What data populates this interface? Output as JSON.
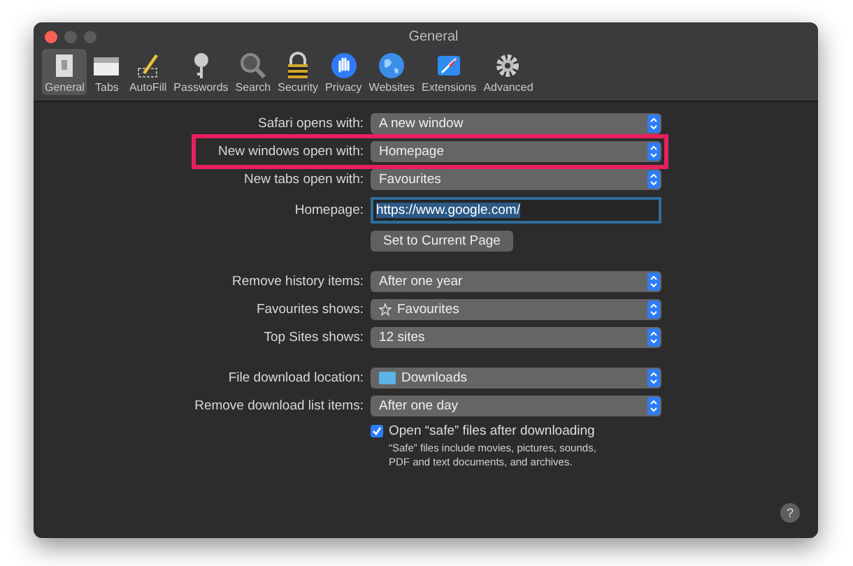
{
  "window": {
    "title": "General"
  },
  "toolbar": [
    {
      "label": "General",
      "selected": true
    },
    {
      "label": "Tabs",
      "selected": false
    },
    {
      "label": "AutoFill",
      "selected": false
    },
    {
      "label": "Passwords",
      "selected": false
    },
    {
      "label": "Search",
      "selected": false
    },
    {
      "label": "Security",
      "selected": false
    },
    {
      "label": "Privacy",
      "selected": false
    },
    {
      "label": "Websites",
      "selected": false
    },
    {
      "label": "Extensions",
      "selected": false
    },
    {
      "label": "Advanced",
      "selected": false
    }
  ],
  "sections": [
    {
      "rows": [
        {
          "kind": "popup",
          "label": "Safari opens with:",
          "value": "A new window",
          "highlighted": false
        },
        {
          "kind": "popup",
          "label": "New windows open with:",
          "value": "Homepage",
          "highlighted": true
        },
        {
          "kind": "popup",
          "label": "New tabs open with:",
          "value": "Favourites",
          "highlighted": false
        },
        {
          "kind": "field",
          "label": "Homepage:",
          "value": "https://www.google.com/",
          "highlighted": false
        },
        {
          "kind": "button",
          "value": "Set to Current Page",
          "highlighted": false
        }
      ]
    },
    {
      "rows": [
        {
          "kind": "popup",
          "label": "Remove history items:",
          "value": "After one year",
          "highlighted": false
        },
        {
          "kind": "starpopup",
          "label": "Favourites shows:",
          "value": "Favourites",
          "highlighted": false
        },
        {
          "kind": "popup",
          "label": "Top Sites shows:",
          "value": "12 sites",
          "highlighted": false
        }
      ]
    },
    {
      "rows": [
        {
          "kind": "folderpopup",
          "label": "File download location:",
          "value": "Downloads",
          "highlighted": false
        },
        {
          "kind": "popup",
          "label": "Remove download list items:",
          "value": "After one day",
          "highlighted": false
        },
        {
          "kind": "checkbox",
          "value": "Open “safe” files after downloading",
          "checked": true,
          "note": "“Safe” files include movies, pictures, sounds, PDF and text documents, and archives.",
          "highlighted": false
        }
      ]
    }
  ],
  "help": "?"
}
